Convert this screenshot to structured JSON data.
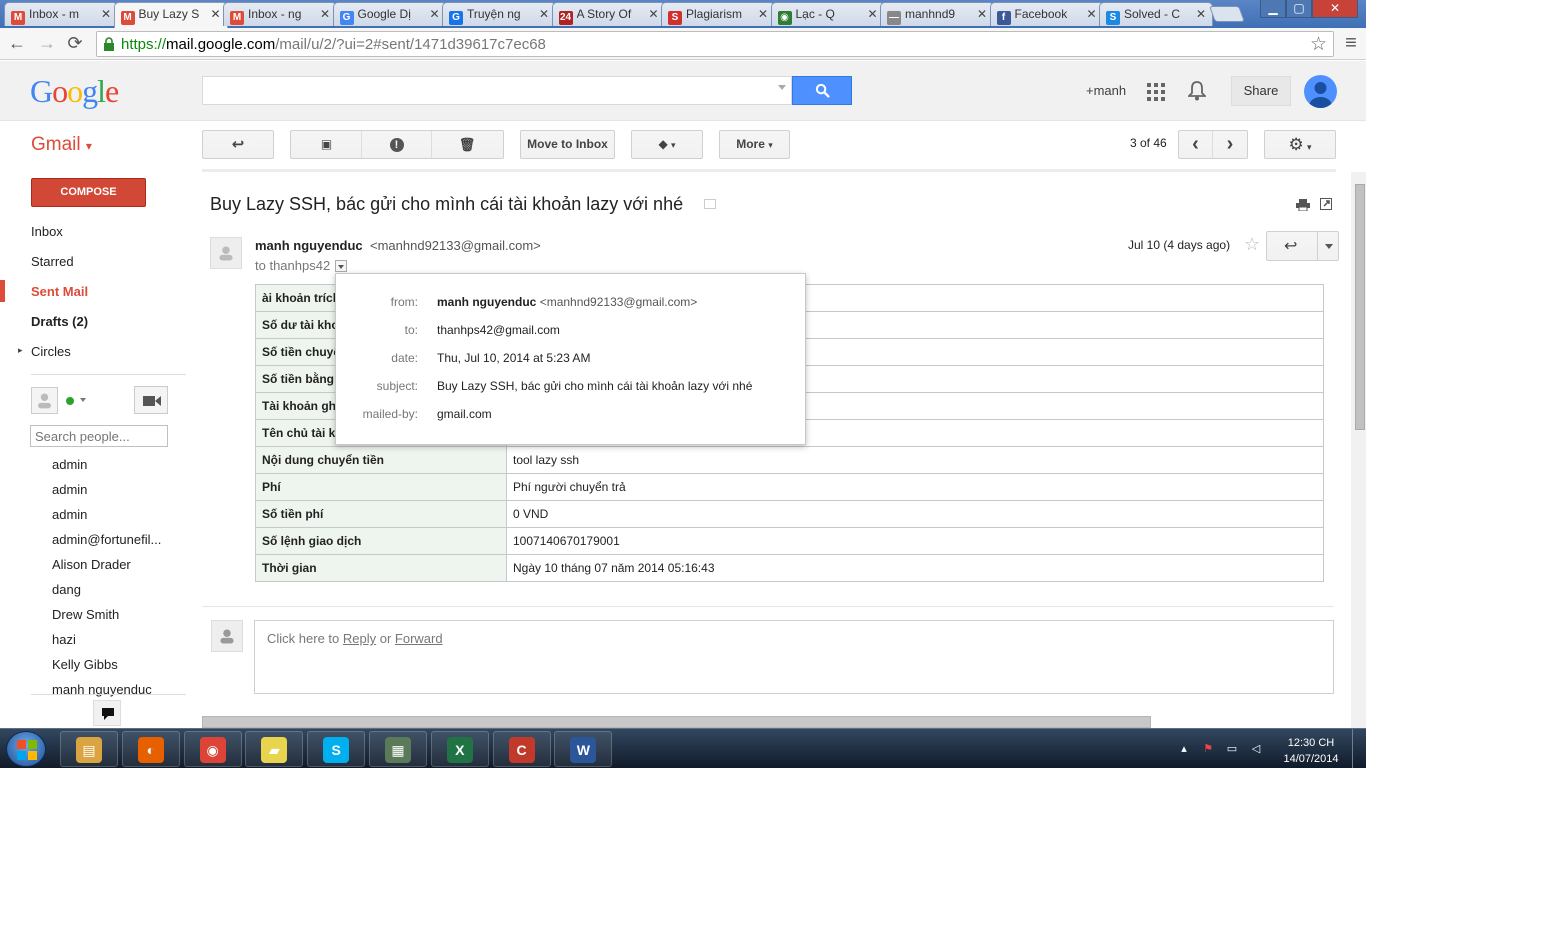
{
  "browser": {
    "tabs": [
      {
        "label": "Inbox - m",
        "fav": "M",
        "color": "#dd4b39"
      },
      {
        "label": "Buy Lazy S",
        "fav": "M",
        "color": "#dd4b39"
      },
      {
        "label": "Inbox - ng",
        "fav": "M",
        "color": "#dd4b39"
      },
      {
        "label": "Google Dị",
        "fav": "G",
        "color": "#4285f4"
      },
      {
        "label": "Truyện ng",
        "fav": "G",
        "color": "#1a73e8"
      },
      {
        "label": "A Story Of",
        "fav": "24",
        "color": "#b22222"
      },
      {
        "label": "Plagiarism",
        "fav": "S",
        "color": "#d32f2f"
      },
      {
        "label": "Lạc - Q",
        "fav": "◉",
        "color": "#2e7d32"
      },
      {
        "label": "manhnd9",
        "fav": "—",
        "color": "#888888"
      },
      {
        "label": "Facebook",
        "fav": "f",
        "color": "#3b5998"
      },
      {
        "label": "Solved - C",
        "fav": "S",
        "color": "#1e88e5"
      }
    ],
    "close_glyph": "✕",
    "window_buttons": {
      "minimize": "▁",
      "maximize": "▢",
      "close": "✕"
    },
    "url": {
      "scheme": "https://",
      "host": "mail.google.com",
      "path": "/mail/u/2/?ui=2#sent/1471d39617c7ec68"
    },
    "nav_icons": [
      "back-arrow-icon",
      "forward-arrow-icon",
      "reload-icon"
    ],
    "nav_glyphs": {
      "back": "←",
      "forward": "→",
      "reload": "⟳",
      "star": "☆",
      "menu": "≡"
    }
  },
  "header": {
    "logo": [
      {
        "ch": "G",
        "color": "#4285f4"
      },
      {
        "ch": "o",
        "color": "#ea4335"
      },
      {
        "ch": "o",
        "color": "#fbbc05"
      },
      {
        "ch": "g",
        "color": "#4285f4"
      },
      {
        "ch": "l",
        "color": "#34a853"
      },
      {
        "ch": "e",
        "color": "#ea4335"
      }
    ],
    "search_value": "",
    "plus_name": "+manh",
    "share_label": "Share",
    "apps_icon": "apps-grid-icon",
    "notification_icon": "bell-icon"
  },
  "gmail": {
    "label": "Gmail",
    "label_arrow": "▾",
    "compose": "COMPOSE",
    "toolbar": {
      "move_to_inbox": "Move to Inbox",
      "more": "More",
      "caret": "▾",
      "page_info": "3 of 46",
      "glyphs": {
        "back": "↩",
        "archive": "▣",
        "spam": "!",
        "trash": "🗑",
        "label": "◆",
        "prev": "‹",
        "next": "›",
        "settings": "⚙"
      }
    },
    "nav": [
      {
        "label": "Inbox",
        "style": ""
      },
      {
        "label": "Starred",
        "style": ""
      },
      {
        "label": "Sent Mail",
        "style": "active"
      },
      {
        "label": "Drafts (2)",
        "style": "bold"
      },
      {
        "label": "Circles",
        "style": ""
      }
    ],
    "circles_caret": "▸",
    "search_people_placeholder": "Search people...",
    "contacts": [
      "admin",
      "admin",
      "admin",
      "admin@fortunefil...",
      "Alison Drader",
      "dang",
      "Drew Smith",
      "hazi",
      "Kelly Gibbs",
      "manh nguyenduc"
    ]
  },
  "email": {
    "subject": "Buy Lazy SSH, bác gửi cho mình cái tài khoản lazy với nhé",
    "sender_name": "manh nguyenduc",
    "sender_email": "<manhnd92133@gmail.com>",
    "to_line": "to thanhps42",
    "date": "Jul 10 (4 days ago)",
    "star": "☆",
    "reply_glyph": "↩",
    "rows": [
      {
        "k": "ài khoản trích",
        "v": ""
      },
      {
        "k": "Số dư tài kho",
        "v": ""
      },
      {
        "k": "Số tiền chuyể",
        "v": ""
      },
      {
        "k": "Số tiền bằng",
        "v": ""
      },
      {
        "k": "Tài khoản ghi",
        "v": ""
      },
      {
        "k": "Tên chủ tài kl",
        "v": ""
      },
      {
        "k": "Nội dung chuyển tiền",
        "v": "tool lazy ssh"
      },
      {
        "k": "Phí",
        "v": "Phí người chuyển trả"
      },
      {
        "k": "Số tiền phí",
        "v": "0 VND"
      },
      {
        "k": "Số lệnh giao dịch",
        "v": "1007140670179001"
      },
      {
        "k": "Thời gian",
        "v": "Ngày 10 tháng 07 năm 2014 05:16:43"
      }
    ],
    "details": {
      "from_label": "from:",
      "from_name": "manh nguyenduc",
      "from_email": "<manhnd92133@gmail.com>",
      "to_label": "to:",
      "to_value": "thanhps42@gmail.com",
      "date_label": "date:",
      "date_value": "Thu, Jul 10, 2014 at 5:23 AM",
      "subject_label": "subject:",
      "subject_value": "Buy Lazy SSH, bác gửi cho mình cái tài khoản lazy với nhé",
      "mailedby_label": "mailed-by:",
      "mailedby_value": "gmail.com"
    },
    "reply_prompt": "Click here to ",
    "reply_link": "Reply",
    "or_text": " or ",
    "forward_link": "Forward"
  },
  "taskbar": {
    "apps": [
      {
        "name": "explorer",
        "glyph": "▤",
        "color": "#d9a441"
      },
      {
        "name": "firefox",
        "glyph": "◐",
        "color": "#e66000"
      },
      {
        "name": "chrome",
        "glyph": "◉",
        "color": "#db4437"
      },
      {
        "name": "sticky-notes",
        "glyph": "▰",
        "color": "#e8d44d"
      },
      {
        "name": "skype",
        "glyph": "S",
        "color": "#00aff0"
      },
      {
        "name": "task-manager",
        "glyph": "▦",
        "color": "#5a7a5a"
      },
      {
        "name": "excel",
        "glyph": "X",
        "color": "#217346"
      },
      {
        "name": "ccleaner",
        "glyph": "C",
        "color": "#c0392b"
      },
      {
        "name": "word",
        "glyph": "W",
        "color": "#2b579a"
      }
    ],
    "tray_glyphs": {
      "caret": "▴",
      "flag": "⚑",
      "network": "▭",
      "volume": "◁"
    },
    "time": "12:30 CH",
    "date": "14/07/2014"
  }
}
